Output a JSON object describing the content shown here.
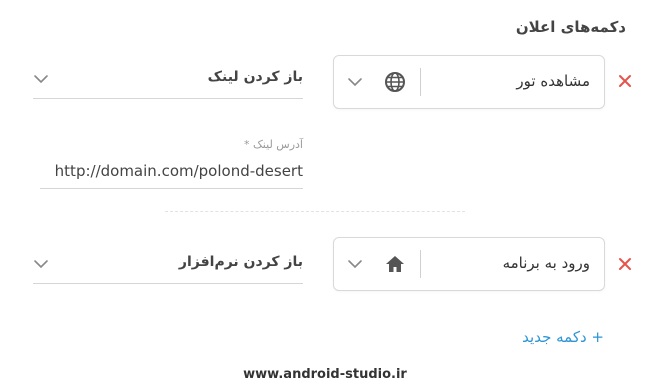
{
  "section": {
    "title": "دکمه‌های اعلان"
  },
  "buttons": [
    {
      "label": "مشاهده تور",
      "icon": "globe-icon",
      "action": "باز کردن لینک",
      "url_caption": "آدرس لینک *",
      "url_value": "http://domain.com/polond-desert"
    },
    {
      "label": "ورود به برنامه",
      "icon": "home-icon",
      "action": "باز کردن نرم‌افزار"
    }
  ],
  "add_button": {
    "label": "+ دکمه جدید"
  },
  "footer": {
    "site": "www.android-studio.ir"
  },
  "colors": {
    "remove": "#e5534b",
    "link": "#2b95d6",
    "border": "#d9d9d9"
  }
}
